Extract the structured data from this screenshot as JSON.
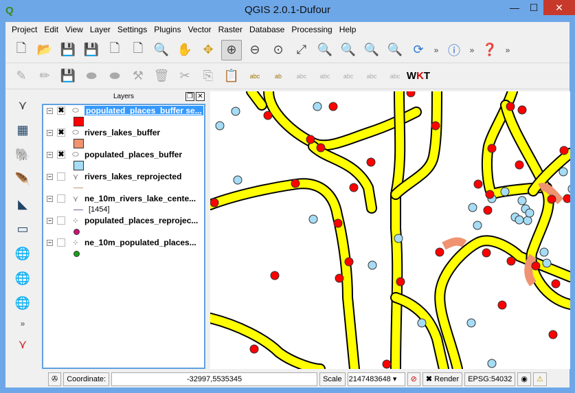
{
  "window": {
    "title": "QGIS 2.0.1-Dufour",
    "minimize": "—",
    "maximize": "☐",
    "close": "✕"
  },
  "menu": [
    "Project",
    "Edit",
    "View",
    "Layer",
    "Settings",
    "Plugins",
    "Vector",
    "Raster",
    "Database",
    "Processing",
    "Help"
  ],
  "layers_panel": {
    "title": "Layers",
    "layers": [
      {
        "name": "populated_places_buffer se...",
        "checked": true,
        "selected": true,
        "type": "polygon",
        "color": "#ff0000"
      },
      {
        "name": "rivers_lakes_buffer",
        "checked": true,
        "selected": false,
        "type": "polygon",
        "color": "#ef9370"
      },
      {
        "name": "populated_places_buffer",
        "checked": true,
        "selected": false,
        "type": "polygon",
        "color": "#a6dcf5"
      },
      {
        "name": "rivers_lakes_reprojected",
        "checked": false,
        "selected": false,
        "type": "line",
        "color": "#b89a70"
      },
      {
        "name": "ne_10m_rivers_lake_cente...",
        "checked": false,
        "selected": false,
        "type": "line",
        "color": "#7a5f9a",
        "count": "[1454]"
      },
      {
        "name": "populated_places_reprojec...",
        "checked": false,
        "selected": false,
        "type": "point",
        "color": "#d0107a"
      },
      {
        "name": "ne_10m_populated_places...",
        "checked": false,
        "selected": false,
        "type": "point",
        "color": "#1aa01a"
      }
    ]
  },
  "statusbar": {
    "coordinate_label": "Coordinate:",
    "coordinate": "-32997,5535345",
    "scale_label": "Scale",
    "scale": "2147483648",
    "render_label": "Render",
    "render_checked": true,
    "crs": "EPSG:54032"
  },
  "colors": {
    "buffer_fill": "#ffff00",
    "selected": "#ff0000",
    "places": "#a6dcf5",
    "rivers_buffer": "#ef9370"
  }
}
